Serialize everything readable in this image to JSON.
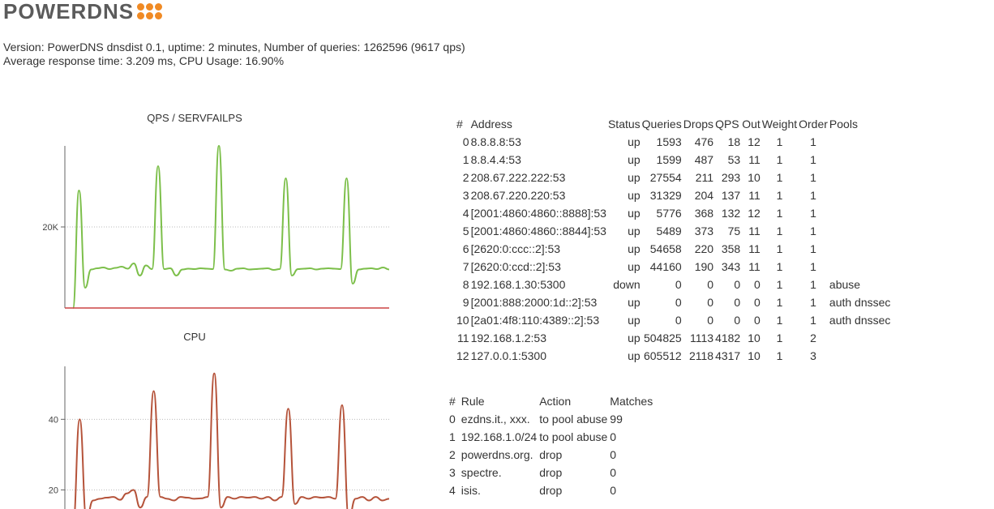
{
  "logo": {
    "text": "POWERDNS"
  },
  "info": {
    "line1": "Version: PowerDNS dnsdist 0.1, uptime: 2 minutes, Number of queries: 1262596 (9617 qps)",
    "line2": "Average response time: 3.209 ms, CPU Usage: 16.90%"
  },
  "charts": {
    "qps_title": "QPS / SERVFAILPS",
    "cpu_title": "CPU"
  },
  "chart_data": [
    {
      "type": "line",
      "title": "QPS / SERVFAILPS",
      "ylim": [
        0,
        40000
      ],
      "yticks": [
        "20K"
      ],
      "grid": true,
      "series": [
        {
          "color": "#7cbf4a",
          "values": [
            0,
            29000,
            5000,
            9500,
            9800,
            10000,
            9600,
            9900,
            10200,
            9700,
            11000,
            8000,
            10500,
            9600,
            35000,
            9600,
            9800,
            8000,
            9500,
            9700,
            9600,
            9800,
            9700,
            9600,
            40000,
            9500,
            9200,
            9700,
            9800,
            9500,
            9600,
            9700,
            9800,
            9400,
            9600,
            32000,
            8000,
            9600,
            9700,
            9800,
            9500,
            9700,
            9800,
            9700,
            9600,
            32000,
            6000,
            9500,
            9700,
            9800,
            9600,
            10000,
            9500
          ]
        },
        {
          "color": "#cc4444",
          "values": [
            0
          ]
        }
      ]
    },
    {
      "type": "line",
      "title": "CPU",
      "ylim": [
        10,
        55
      ],
      "yticks": [
        "40",
        "20"
      ],
      "grid": true,
      "series": [
        {
          "color": "#b5533a",
          "values": [
            10,
            40,
            12,
            17,
            17.5,
            17.8,
            18,
            17.2,
            19,
            20,
            15,
            18,
            48,
            18,
            17.5,
            17,
            18,
            17.8,
            17.5,
            17.6,
            18,
            53,
            15,
            18,
            17.5,
            18,
            17.8,
            18,
            17.5,
            18,
            17,
            18,
            43,
            16,
            18,
            17.5,
            18,
            17.8,
            18,
            17.5,
            44,
            12,
            17.5,
            18,
            17,
            18,
            17,
            17.5
          ]
        }
      ]
    }
  ],
  "servers": {
    "headers": [
      "#",
      "Address",
      "Status",
      "Queries",
      "Drops",
      "QPS",
      "Out",
      "Weight",
      "Order",
      "Pools"
    ],
    "rows": [
      [
        "0",
        "8.8.8.8:53",
        "up",
        "1593",
        "476",
        "18",
        "12",
        "1",
        "1",
        ""
      ],
      [
        "1",
        "8.8.4.4:53",
        "up",
        "1599",
        "487",
        "53",
        "11",
        "1",
        "1",
        ""
      ],
      [
        "2",
        "208.67.222.222:53",
        "up",
        "27554",
        "211",
        "293",
        "10",
        "1",
        "1",
        ""
      ],
      [
        "3",
        "208.67.220.220:53",
        "up",
        "31329",
        "204",
        "137",
        "11",
        "1",
        "1",
        ""
      ],
      [
        "4",
        "[2001:4860:4860::8888]:53",
        "up",
        "5776",
        "368",
        "132",
        "12",
        "1",
        "1",
        ""
      ],
      [
        "5",
        "[2001:4860:4860::8844]:53",
        "up",
        "5489",
        "373",
        "75",
        "11",
        "1",
        "1",
        ""
      ],
      [
        "6",
        "[2620:0:ccc::2]:53",
        "up",
        "54658",
        "220",
        "358",
        "11",
        "1",
        "1",
        ""
      ],
      [
        "7",
        "[2620:0:ccd::2]:53",
        "up",
        "44160",
        "190",
        "343",
        "11",
        "1",
        "1",
        ""
      ],
      [
        "8",
        "192.168.1.30:5300",
        "down",
        "0",
        "0",
        "0",
        "0",
        "1",
        "1",
        "abuse"
      ],
      [
        "9",
        "[2001:888:2000:1d::2]:53",
        "up",
        "0",
        "0",
        "0",
        "0",
        "1",
        "1",
        "auth dnssec"
      ],
      [
        "10",
        "[2a01:4f8:110:4389::2]:53",
        "up",
        "0",
        "0",
        "0",
        "0",
        "1",
        "1",
        "auth dnssec"
      ],
      [
        "11",
        "192.168.1.2:53",
        "up",
        "504825",
        "1113",
        "4182",
        "10",
        "1",
        "2",
        ""
      ],
      [
        "12",
        "127.0.0.1:5300",
        "up",
        "605512",
        "2118",
        "4317",
        "10",
        "1",
        "3",
        ""
      ]
    ]
  },
  "rules": {
    "headers": [
      "#",
      "Rule",
      "Action",
      "Matches"
    ],
    "rows": [
      [
        "0",
        "ezdns.it., xxx.",
        "to pool abuse",
        "99"
      ],
      [
        "1",
        "192.168.1.0/24",
        "to pool abuse",
        "0"
      ],
      [
        "2",
        "powerdns.org.",
        "drop",
        "0"
      ],
      [
        "3",
        "spectre.",
        "drop",
        "0"
      ],
      [
        "4",
        "isis.",
        "drop",
        "0"
      ]
    ]
  }
}
